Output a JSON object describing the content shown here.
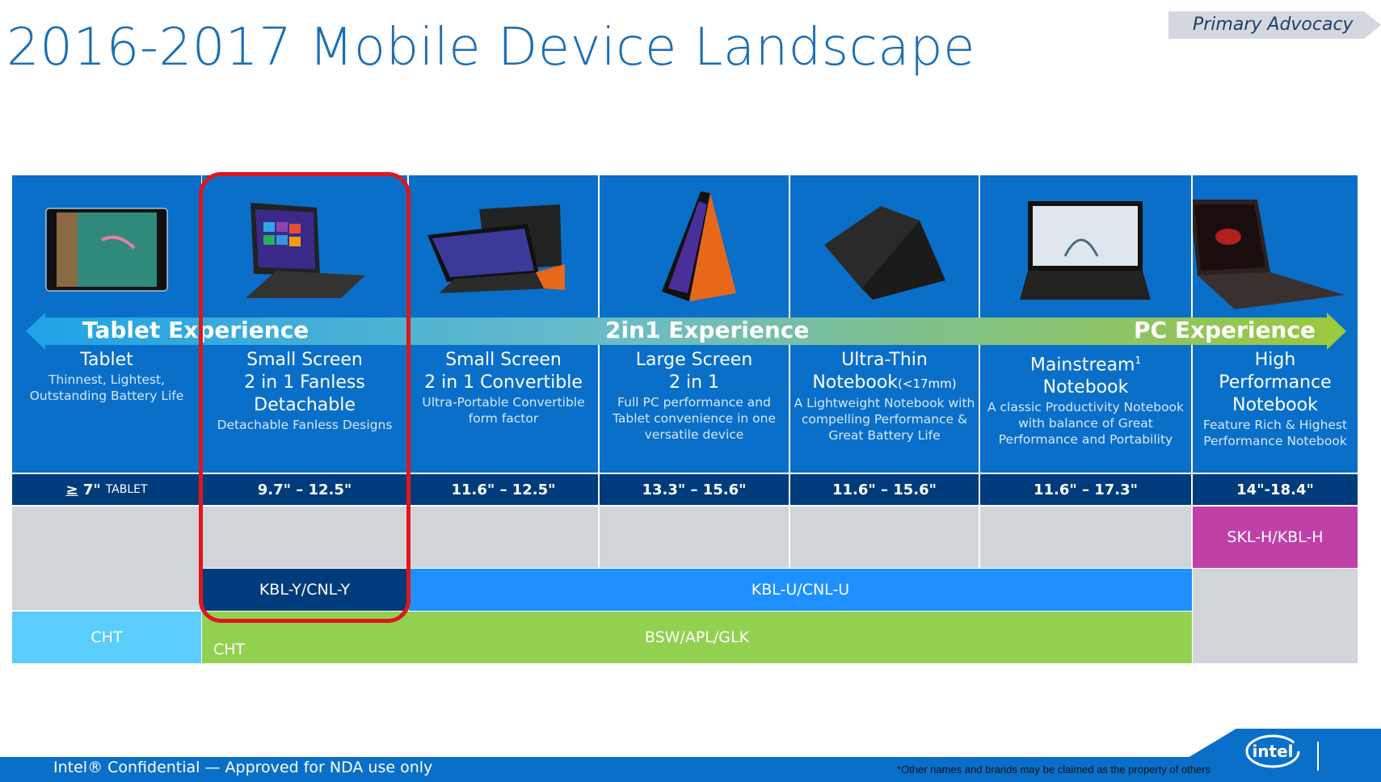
{
  "title": "2016-2017 Mobile Device Landscape",
  "badge": "Primary Advocacy",
  "experience_arrow": {
    "labels": [
      "Tablet Experience",
      "2in1 Experience",
      "PC Experience"
    ],
    "colors": [
      "#1ea3e8",
      "#7fc4a4",
      "#9cc83a"
    ]
  },
  "columns": [
    {
      "title": "Tablet",
      "title_lines": [
        "Tablet"
      ],
      "desc": [
        "Thinnest, Lightest,",
        "Outstanding Battery Life"
      ],
      "size_prefix": "≥",
      "size": "7\"",
      "size_suffix": "TABLET",
      "image": "tablet-image"
    },
    {
      "title_lines": [
        "Small Screen",
        "2 in 1 Fanless",
        "Detachable"
      ],
      "desc": [
        "Detachable Fanless Designs"
      ],
      "size": "9.7\" – 12.5\"",
      "image": "detachable-image"
    },
    {
      "title_lines": [
        "Small Screen",
        "2 in 1 Convertible"
      ],
      "desc": [
        "Ultra-Portable Convertible",
        "form factor"
      ],
      "size": "11.6\" – 12.5\"",
      "image": "convertible-image"
    },
    {
      "title_lines": [
        "Large Screen",
        "2 in 1"
      ],
      "desc": [
        "Full PC performance and",
        "Tablet convenience in one",
        "versatile device"
      ],
      "size": "13.3\" – 15.6\"",
      "image": "large-2in1-image"
    },
    {
      "title_lines": [
        "Ultra-Thin",
        "Notebook"
      ],
      "title_suffix": "(<17mm)",
      "desc": [
        "A Lightweight Notebook with",
        "compelling Performance &",
        "Great Battery Life"
      ],
      "size": "11.6\" – 15.6\"",
      "image": "ultrathin-image"
    },
    {
      "title_lines": [
        "Mainstream",
        "Notebook"
      ],
      "title_sup": "1",
      "desc": [
        "A classic Productivity Notebook",
        "with balance of Great",
        "Performance and Portability"
      ],
      "size": "11.6\" – 17.3\"",
      "image": "mainstream-image"
    },
    {
      "title_lines": [
        "High",
        "Performance",
        "Notebook"
      ],
      "desc": [
        "Feature Rich & Highest",
        "Performance Notebook"
      ],
      "size": "14\"-18.4\"",
      "image": "highperf-image"
    }
  ],
  "platforms": {
    "skl_h": {
      "label": "SKL-H/KBL-H",
      "color": "#c040a8"
    },
    "kbl_y": {
      "label": "KBL-Y/CNL-Y",
      "color": "#003c7c"
    },
    "kbl_u": {
      "label": "KBL-U/CNL-U",
      "color": "#1e90ff"
    },
    "cht_tablet": {
      "label": "CHT",
      "color": "#5bcdfb"
    },
    "bsw": {
      "label": "BSW/APL/GLK",
      "sub_label": "CHT",
      "color": "#92d050"
    }
  },
  "highlight_color": "#e0161b",
  "footer": {
    "confidential": "Intel® Confidential — Approved for NDA use only",
    "note": "*Other names and brands may be claimed as the property of others",
    "logo": "intel"
  }
}
